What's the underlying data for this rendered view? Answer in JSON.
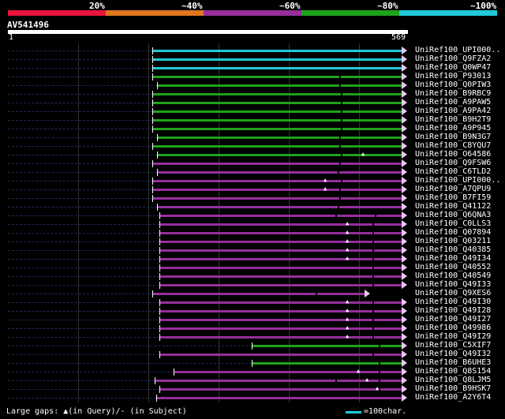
{
  "legend": {
    "segments": [
      {
        "label": "",
        "color": "#e8143c"
      },
      {
        "label": "20%",
        "color": "#e0761e"
      },
      {
        "label": "~40%",
        "color": "#962e9c"
      },
      {
        "label": "~60%",
        "color": "#1fa21c"
      },
      {
        "label": "~80%",
        "color": "#1fc9d6"
      },
      {
        "label": "~100%",
        "color": ""
      }
    ]
  },
  "query": {
    "title": "AV541496",
    "start_label": "1",
    "end_label": "569"
  },
  "hits": [
    {
      "name": "UniRef100_UPI000..",
      "color": "#1fc9d6"
    },
    {
      "name": "UniRef100_Q9FZA2",
      "color": "#1fc9d6"
    },
    {
      "name": "UniRef100_Q0WP47",
      "color": "#1fc9d6"
    },
    {
      "name": "UniRef100_P93013",
      "color": "#1fa21c"
    },
    {
      "name": "UniRef100_Q0PIW3",
      "color": "#1fa21c"
    },
    {
      "name": "UniRef100_B9RBC9",
      "color": "#1fa21c"
    },
    {
      "name": "UniRef100_A9PAW5",
      "color": "#1fa21c"
    },
    {
      "name": "UniRef100_A9PA42",
      "color": "#1fa21c"
    },
    {
      "name": "UniRef100_B9H2T9",
      "color": "#1fa21c"
    },
    {
      "name": "UniRef100_A9P945",
      "color": "#1fa21c"
    },
    {
      "name": "UniRef100_B9N3G7",
      "color": "#1fa21c"
    },
    {
      "name": "UniRef100_C8YQU7",
      "color": "#1fa21c"
    },
    {
      "name": "UniRef100_O64586",
      "color": "#1fa21c"
    },
    {
      "name": "UniRef100_Q9FSW6",
      "color": "#962e9c"
    },
    {
      "name": "UniRef100_C6TLD2",
      "color": "#962e9c"
    },
    {
      "name": "UniRef100_UPI000..",
      "color": "#962e9c"
    },
    {
      "name": "UniRef100_A7QPU9",
      "color": "#962e9c"
    },
    {
      "name": "UniRef100_B7FI59",
      "color": "#962e9c"
    },
    {
      "name": "UniRef100_Q41122",
      "color": "#962e9c"
    },
    {
      "name": "UniRef100_Q6QNA3",
      "color": "#962e9c"
    },
    {
      "name": "UniRef100_C0LLS3",
      "color": "#962e9c"
    },
    {
      "name": "UniRef100_Q07894",
      "color": "#962e9c"
    },
    {
      "name": "UniRef100_Q03211",
      "color": "#962e9c"
    },
    {
      "name": "UniRef100_Q40385",
      "color": "#962e9c"
    },
    {
      "name": "UniRef100_Q49I34",
      "color": "#962e9c"
    },
    {
      "name": "UniRef100_Q40552",
      "color": "#962e9c"
    },
    {
      "name": "UniRef100_Q40549",
      "color": "#962e9c"
    },
    {
      "name": "UniRef100_Q49I33",
      "color": "#962e9c"
    },
    {
      "name": "UniRef100_Q9XES6",
      "color": "#962e9c"
    },
    {
      "name": "UniRef100_Q49I30",
      "color": "#962e9c"
    },
    {
      "name": "UniRef100_Q49I28",
      "color": "#962e9c"
    },
    {
      "name": "UniRef100_Q49I27",
      "color": "#962e9c"
    },
    {
      "name": "UniRef100_Q49986",
      "color": "#962e9c"
    },
    {
      "name": "UniRef100_Q49I29",
      "color": "#962e9c"
    },
    {
      "name": "UniRef100_C5XIF7",
      "color": "#1fa21c"
    },
    {
      "name": "UniRef100_Q49I32",
      "color": "#962e9c"
    },
    {
      "name": "UniRef100_B6UHE3",
      "color": "#1fa21c"
    },
    {
      "name": "UniRef100_Q8S154",
      "color": "#962e9c"
    },
    {
      "name": "UniRef100_Q8LJM5",
      "color": "#962e9c"
    },
    {
      "name": "UniRef100_B9HSK7",
      "color": "#962e9c"
    },
    {
      "name": "UniRef100_A2Y6T4",
      "color": "#962e9c"
    }
  ],
  "footer": {
    "gaps_text": "Large gaps: ▲(in Query)/- (in Subject)",
    "scale_text": "=100char."
  }
}
